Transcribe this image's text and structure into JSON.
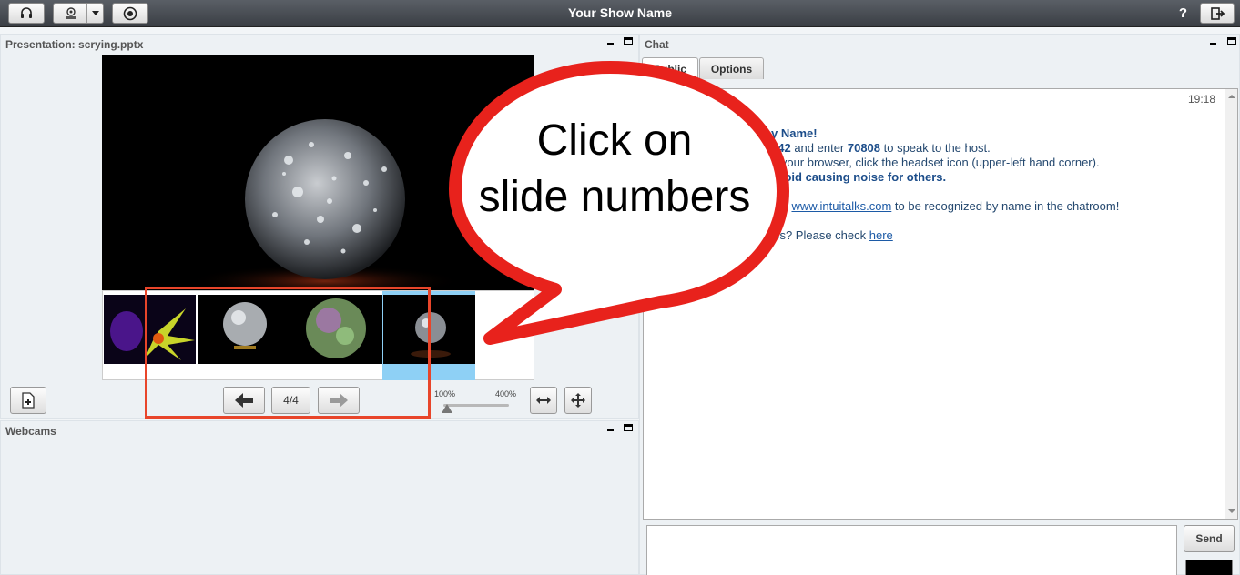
{
  "topbar": {
    "title": "Your Show Name",
    "help": "?",
    "icons": [
      "headset-icon",
      "webcam-icon",
      "dropdown-arrow-icon",
      "record-icon",
      "logout-icon"
    ]
  },
  "presentation": {
    "title": "Presentation: scrying.pptx",
    "slide_counter": "4/4",
    "zoom_min": "100%",
    "zoom_max": "400%",
    "zoom_level": 0.0,
    "thumbnails": 4,
    "selected_thumbnail": 4
  },
  "webcams": {
    "title": "Webcams"
  },
  "chat": {
    "title": "Chat",
    "tabs": [
      {
        "label": "Public"
      },
      {
        "label": "Options"
      }
    ],
    "timestamp": "19:18",
    "line1_bold": "y Name!",
    "line2_num1": "342",
    "line2_mid": " and enter ",
    "line2_num2": "70808",
    "line2_end": " to speak to the host.",
    "line3": "a your browser, click the headset icon (upper-left hand corner).",
    "line4_bold": "avoid causing noise for others.",
    "line5_start": "at ",
    "line5_link": "www.intuitalks.com",
    "line5_end": " to be recognized by name in the chatroom!",
    "line6_start": "ssues? Please check ",
    "line6_link": "here",
    "send_label": "Send"
  },
  "overlay": {
    "bubble_line1": "Click on",
    "bubble_line2": "slide numbers",
    "colors": {
      "bubble_border": "#e8221c",
      "highlight_box": "#e8452a"
    }
  }
}
